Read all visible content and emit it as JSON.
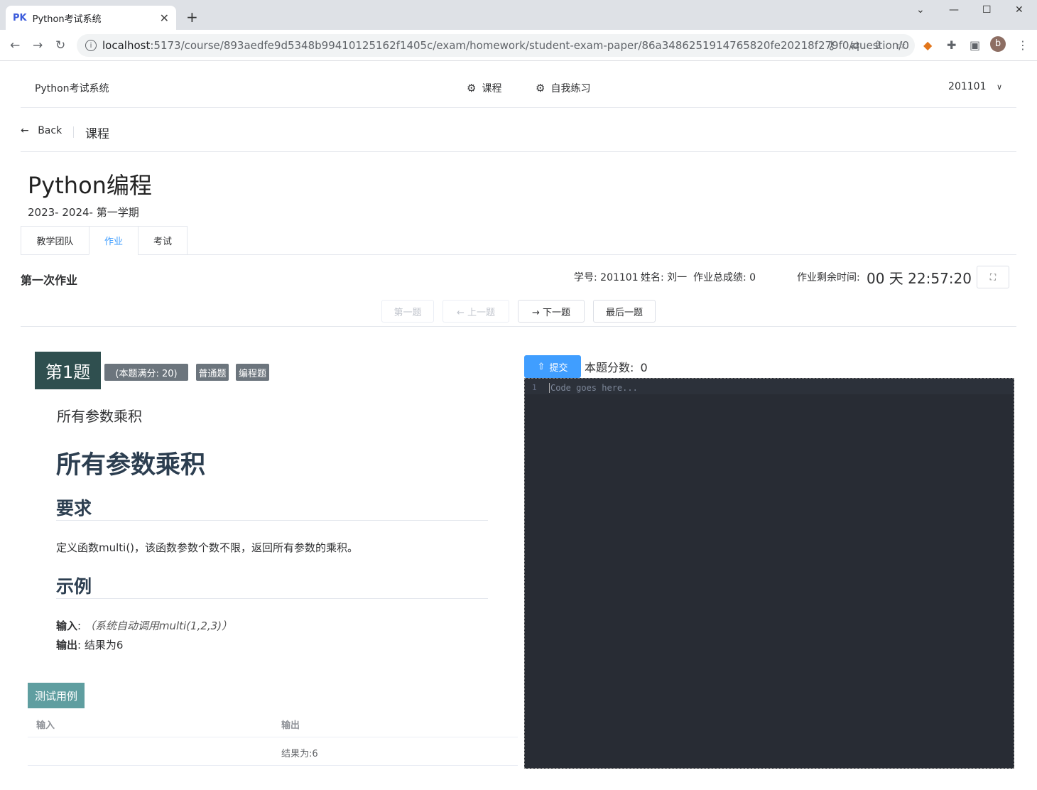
{
  "browser": {
    "tab_favicon": "PK",
    "tab_title": "Python考试系统",
    "url_host": "localhost",
    "url_path": ":5173/course/893aedfe9d5348b99410125162f1405c/exam/homework/student-exam-paper/86a3486251914765820fe20218f279f0/question/0",
    "profile_initial": "b"
  },
  "nav": {
    "brand": "Python考试系统",
    "menu": [
      {
        "label": "课程"
      },
      {
        "label": "自我练习"
      }
    ],
    "user": "201101"
  },
  "backbar": {
    "back": "Back",
    "crumb": "课程"
  },
  "course": {
    "title": "Python编程",
    "term": "2023- 2024- 第一学期"
  },
  "tabs": [
    {
      "label": "教学团队"
    },
    {
      "label": "作业"
    },
    {
      "label": "考试"
    }
  ],
  "homework": {
    "title": "第一次作业",
    "student_id": "学号: 201101",
    "name": "姓名: 刘一",
    "total": "作业总成绩: 0",
    "remaining_label": "作业剩余时间:",
    "remaining": "00 天 22:57:20"
  },
  "pager": {
    "first": "第一题",
    "prev": "← 上一题",
    "next": "→ 下一题",
    "last": "最后一题"
  },
  "question": {
    "number": "第1题",
    "full_score": "(本题满分: 20)",
    "tag1": "普通题",
    "tag2": "编程题",
    "subtitle": "所有参数乘积",
    "heading": "所有参数乘积",
    "req_heading": "要求",
    "req_text": "定义函数multi()，该函数参数个数不限，返回所有参数的乘积。",
    "example_heading": "示例",
    "input_label": "输入",
    "input_text": "（系统自动调用multi(1,2,3)）",
    "output_label": "输出",
    "output_text": ": 结果为6"
  },
  "testcases": {
    "header": "测试用例",
    "col_input": "输入",
    "col_output": "输出",
    "rows": [
      {
        "input": "",
        "output": "结果为:6"
      }
    ]
  },
  "editor": {
    "submit": "提交",
    "score_label": "本题分数:",
    "score": "0",
    "line_no": "1",
    "placeholder": "Code goes here..."
  }
}
